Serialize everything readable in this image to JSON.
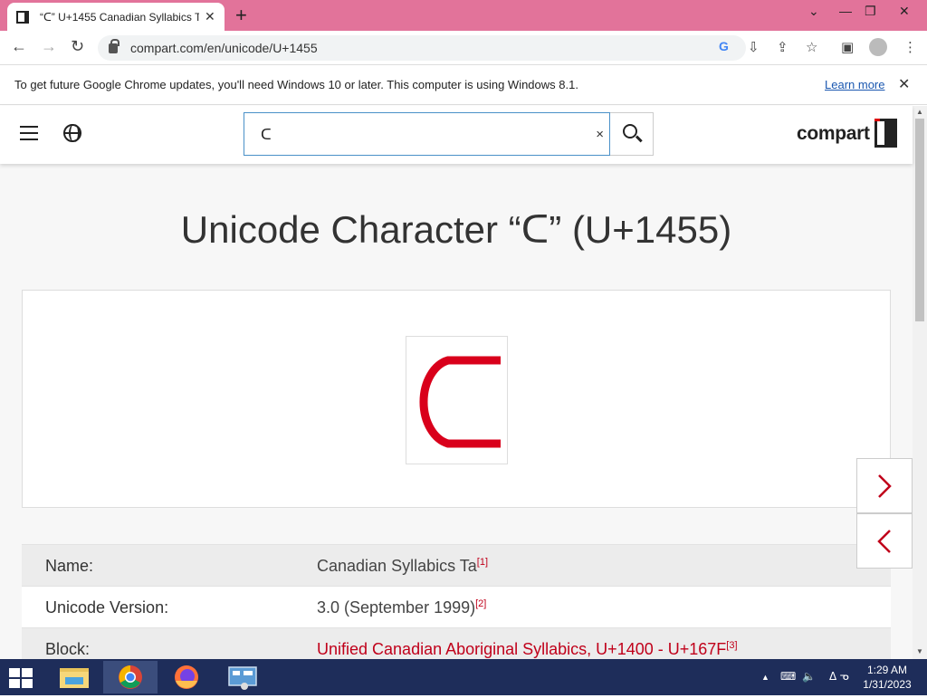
{
  "browser": {
    "tab_title": "“ᑕ” U+1455 Canadian Syllabics Ta",
    "tab_close": "✕",
    "new_tab": "+",
    "url": "compart.com/en/unicode/U+1455",
    "window_controls": {
      "minimize": "—",
      "restore": "❐",
      "close": "✕",
      "tab_list": "⌄"
    }
  },
  "infobar": {
    "message": "To get future Google Chrome updates, you'll need Windows 10 or later. This computer is using Windows 8.1.",
    "learn_more": "Learn more",
    "close": "✕"
  },
  "site": {
    "logo": "compart",
    "search_value": "ᑕ",
    "search_clear": "×"
  },
  "page": {
    "title": "Unicode Character “ᑕ” (U+1455)",
    "glyph_color": "#d9001b",
    "properties": [
      {
        "label": "Name:",
        "value": "Canadian Syllabics Ta",
        "ref": "[1]"
      },
      {
        "label": "Unicode Version:",
        "value": "3.0 (September 1999)",
        "ref": "[2]"
      },
      {
        "label": "Block:",
        "value": "Unified Canadian Aboriginal Syllabics, U+1400 - U+167F",
        "ref": "[3]"
      }
    ]
  },
  "taskbar": {
    "time": "1:29 AM",
    "date": "1/31/2023",
    "input_indicator": "ᐃ ᓀ"
  },
  "colors": {
    "tabstrip": "#e2739a",
    "accent_red": "#c0001a",
    "taskbar": "#1e2d5a"
  }
}
